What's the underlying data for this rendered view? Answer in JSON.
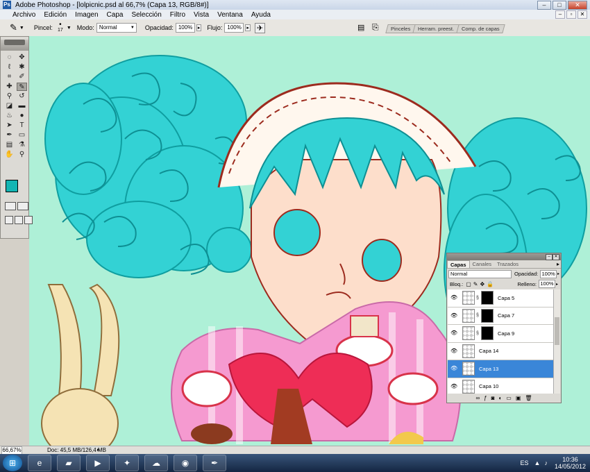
{
  "window": {
    "title": "Adobe Photoshop - [lolpicnic.psd al 66,7% (Capa 13, RGB/8#)]",
    "controls": [
      "minimize-icon",
      "maximize-icon",
      "close-icon"
    ]
  },
  "menu": [
    "Archivo",
    "Edición",
    "Imagen",
    "Capa",
    "Selección",
    "Filtro",
    "Vista",
    "Ventana",
    "Ayuda"
  ],
  "options": {
    "pincel_label": "Pincel:",
    "brush_size": "17",
    "modo_label": "Modo:",
    "modo_value": "Normal",
    "opacidad_label": "Opacidad:",
    "opacidad_value": "100%",
    "flujo_label": "Flujo:",
    "flujo_value": "100%"
  },
  "panel_tabs": [
    "Pinceles",
    "Herram. preest.",
    "Comp. de capas"
  ],
  "toolbox": {
    "tools": [
      "marquee-icon",
      "move-icon",
      "lasso-icon",
      "magic-wand-icon",
      "crop-icon",
      "slice-icon",
      "healing-icon",
      "brush-icon",
      "stamp-icon",
      "history-brush-icon",
      "eraser-icon",
      "gradient-icon",
      "blur-icon",
      "dodge-icon",
      "path-select-icon",
      "type-icon",
      "pen-icon",
      "shape-icon",
      "notes-icon",
      "eyedropper-icon",
      "hand-icon",
      "zoom-icon"
    ],
    "active_tool": "brush-icon",
    "foreground_color": "#13b5b3",
    "background_color": "#ffffff"
  },
  "layers_panel": {
    "tabs": [
      "Capas",
      "Canales",
      "Trazados"
    ],
    "active_tab": "Capas",
    "blend_mode": "Normal",
    "opacity_label": "Opacidad:",
    "opacity_value": "100%",
    "lock_label": "Bloq.:",
    "fill_label": "Relleno:",
    "fill_value": "100%",
    "layers": [
      {
        "name": "Capa 5",
        "mask": true,
        "selected": false
      },
      {
        "name": "Capa 7",
        "mask": true,
        "selected": false
      },
      {
        "name": "Capa 9",
        "mask": true,
        "selected": false
      },
      {
        "name": "Capa 14",
        "mask": false,
        "selected": false
      },
      {
        "name": "Capa 13",
        "mask": false,
        "selected": true
      },
      {
        "name": "Capa 10",
        "mask": false,
        "selected": false
      }
    ]
  },
  "status": {
    "zoom": "66,67%",
    "doc": "Doc: 45,5 MB/126,4 MB"
  },
  "taskbar": {
    "items": [
      "ie-icon",
      "explorer-icon",
      "media-player-icon",
      "photoshop-helper-icon",
      "network-icon",
      "chrome-icon",
      "feather-app-icon"
    ],
    "language": "ES",
    "time": "10:36",
    "date": "14/05/2012"
  },
  "colors": {
    "canvas_bg": "#aef0d7",
    "hair": "#33d2d4",
    "skin": "#fddecb",
    "dress_pink": "#f59ad0",
    "bow": "#ee2d56",
    "rabbit": "#f5e3b4",
    "selected_layer": "#3a86d8"
  }
}
